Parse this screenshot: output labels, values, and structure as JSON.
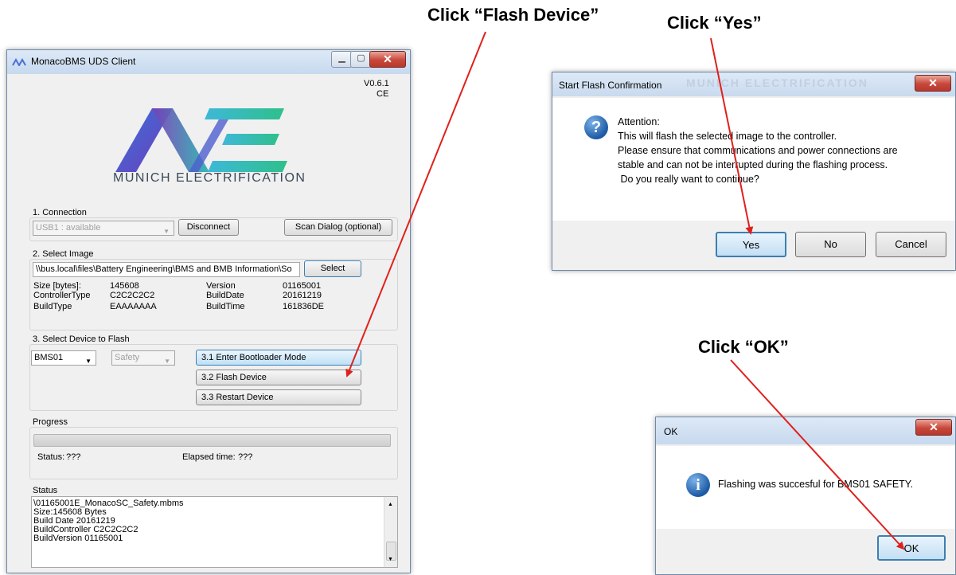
{
  "annotations": {
    "flash_device": "Click “Flash Device”",
    "yes": "Click “Yes”",
    "ok": "Click “OK”"
  },
  "main_window": {
    "title": "MonacoBMS UDS Client",
    "version": "V0.6.1",
    "edition": "CE",
    "logo_text": "MUNICH ELECTRIFICATION",
    "connection": {
      "label": "1. Connection",
      "device_select": "USB1 : available",
      "disconnect_label": "Disconnect",
      "scan_label": "Scan Dialog (optional)"
    },
    "select_image": {
      "label": "2. Select Image",
      "path": "\\\\bus.local\\files\\Battery Engineering\\BMS and BMB Information\\So",
      "select_label": "Select",
      "size_key": "Size [bytes]:",
      "size_val": "145608",
      "controller_key": "ControllerType",
      "controller_val": "C2C2C2C2",
      "buildtype_key": "BuildType",
      "buildtype_val": "EAAAAAAA",
      "version_key": "Version",
      "version_val": "01165001",
      "builddate_key": "BuildDate",
      "builddate_val": "20161219",
      "buildtime_key": "BuildTime",
      "buildtime_val": "161836DE"
    },
    "select_device": {
      "label": "3. Select Device to Flash",
      "device": "BMS01",
      "type": "Safety",
      "enter_bootloader": "3.1 Enter Bootloader Mode",
      "flash_device": "3.2 Flash Device",
      "restart_device": "3.3 Restart Device"
    },
    "progress": {
      "label": "Progress",
      "fill": 0,
      "status_key": "Status:",
      "status_val": "???",
      "elapsed_key": "Elapsed time:",
      "elapsed_val": "???"
    },
    "status": {
      "label": "Status",
      "lines": [
        "\\01165001E_MonacoSC_Safety.mbms",
        "Size:145608 Bytes",
        "Build Date 20161219",
        "BuildController C2C2C2C2",
        "BuildVersion 01165001"
      ]
    }
  },
  "confirm_dialog": {
    "title": "Start Flash Confirmation",
    "watermark": "MUNICH ELECTRIFICATION",
    "icon": "question-icon",
    "lines": [
      "Attention:",
      "This will flash the selected image to the controller.",
      "Please ensure that communications and power connections are",
      "stable and can not be interrupted during the flashing process.",
      " Do you really want to continue?"
    ],
    "yes_label": "Yes",
    "no_label": "No",
    "cancel_label": "Cancel"
  },
  "ok_dialog": {
    "title": "OK",
    "icon": "info-icon",
    "message": "Flashing was succesful for BMS01 SAFETY.",
    "ok_label": "OK"
  },
  "colors": {
    "arrow": "#e0201c",
    "logo_left": "#4b6fd6",
    "logo_mid": "#7a3fb8",
    "logo_right": "#26b3b0"
  }
}
